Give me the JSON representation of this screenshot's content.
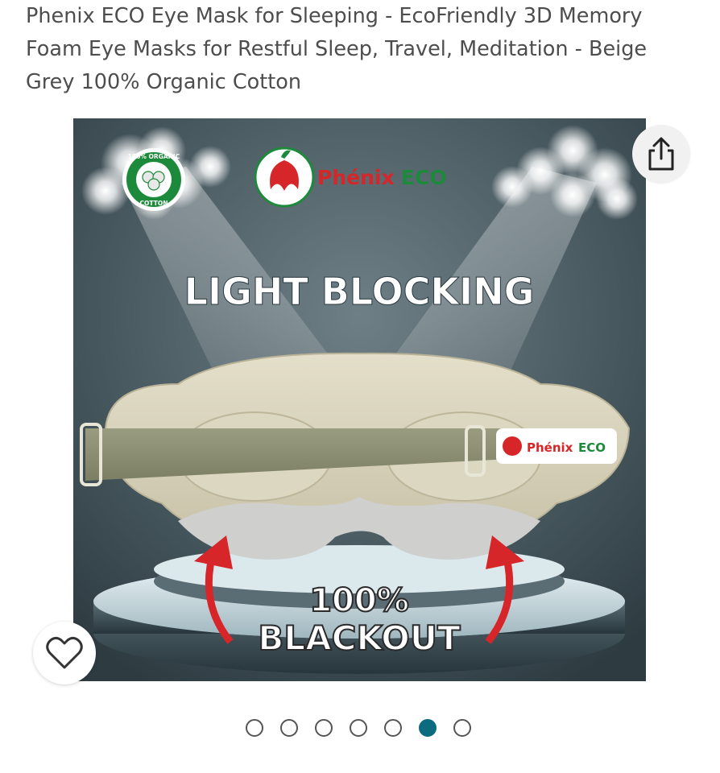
{
  "product": {
    "title": "Phenix ECO Eye Mask for Sleeping - EcoFriendly 3D Memory Foam Eye Masks for Restful Sleep, Travel, Meditation - Beige Grey 100% Organic Cotton"
  },
  "image": {
    "brand": "Phénix ECO",
    "brand_left": "Phénix",
    "brand_right": "ECO",
    "badge_top": "100% ORGANIC",
    "badge_bottom": "COTTON",
    "headline": "LIGHT BLOCKING",
    "callout_line1": "100%",
    "callout_line2": "BLACKOUT",
    "strap_tag_left": "Phénix",
    "strap_tag_right": "ECO"
  },
  "carousel": {
    "count": 7,
    "active_index": 5
  },
  "colors": {
    "accent_teal": "#0c6b7e",
    "brand_red": "#d6262a",
    "brand_green": "#1d8a3b",
    "title_text": "#4d4d4d"
  },
  "icons": {
    "share": "share-icon",
    "favorite": "heart-icon"
  }
}
